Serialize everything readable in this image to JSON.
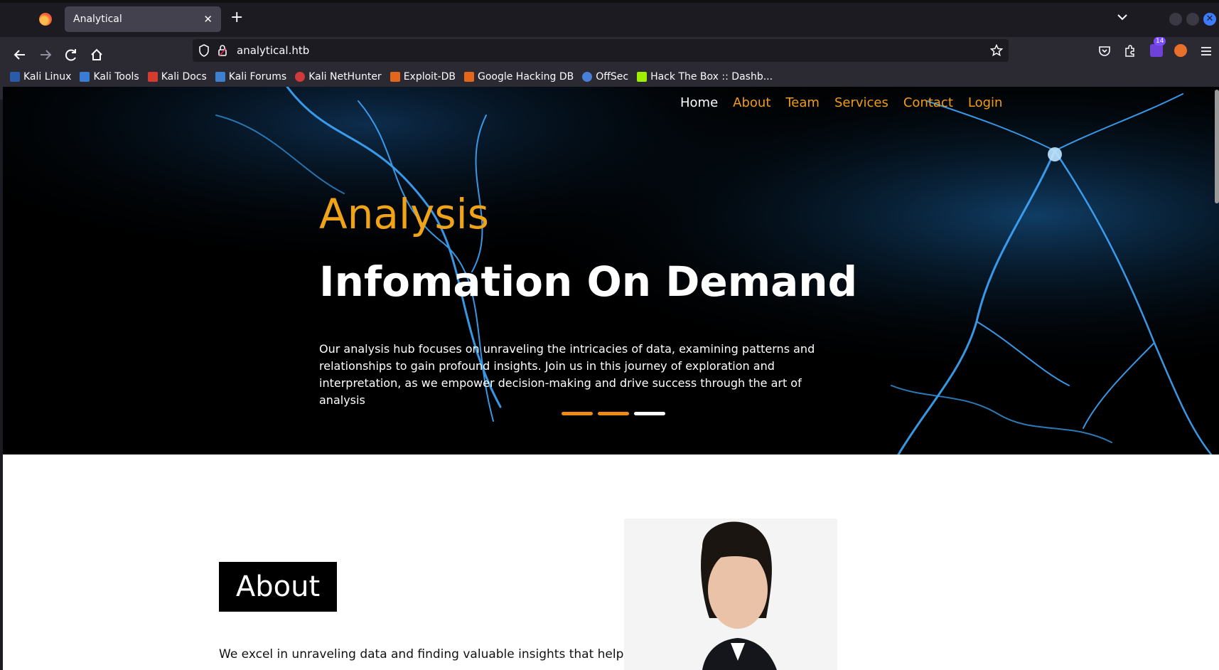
{
  "browser": {
    "tab_title": "Analytical",
    "url": "analytical.htb",
    "bookmarks": [
      {
        "label": "Kali Linux",
        "icon": "kali-icon"
      },
      {
        "label": "Kali Tools",
        "icon": "kali-tools-icon"
      },
      {
        "label": "Kali Docs",
        "icon": "kali-docs-icon"
      },
      {
        "label": "Kali Forums",
        "icon": "kali-forums-icon"
      },
      {
        "label": "Kali NetHunter",
        "icon": "nethunter-icon"
      },
      {
        "label": "Exploit-DB",
        "icon": "exploit-db-icon"
      },
      {
        "label": "Google Hacking DB",
        "icon": "ghdb-icon"
      },
      {
        "label": "OffSec",
        "icon": "offsec-icon"
      },
      {
        "label": "Hack The Box :: Dashb...",
        "icon": "htb-icon"
      }
    ],
    "extension_badge": "14"
  },
  "site": {
    "nav": [
      "Home",
      "About",
      "Team",
      "Services",
      "Contact",
      "Login"
    ],
    "hero": {
      "subtitle": "Analysis",
      "title": "Infomation On Demand",
      "text": "Our analysis hub focuses on unraveling the intricacies of data, examining patterns and relationships to gain profound insights. Join us in this journey of exploration and interpretation, as we empower decision-making and drive success through the art of analysis"
    },
    "about": {
      "heading": "About",
      "text": "We excel in unraveling data and finding valuable insights that help"
    },
    "colors": {
      "accent": "#f39c12",
      "hero_bg": "#000000"
    }
  }
}
